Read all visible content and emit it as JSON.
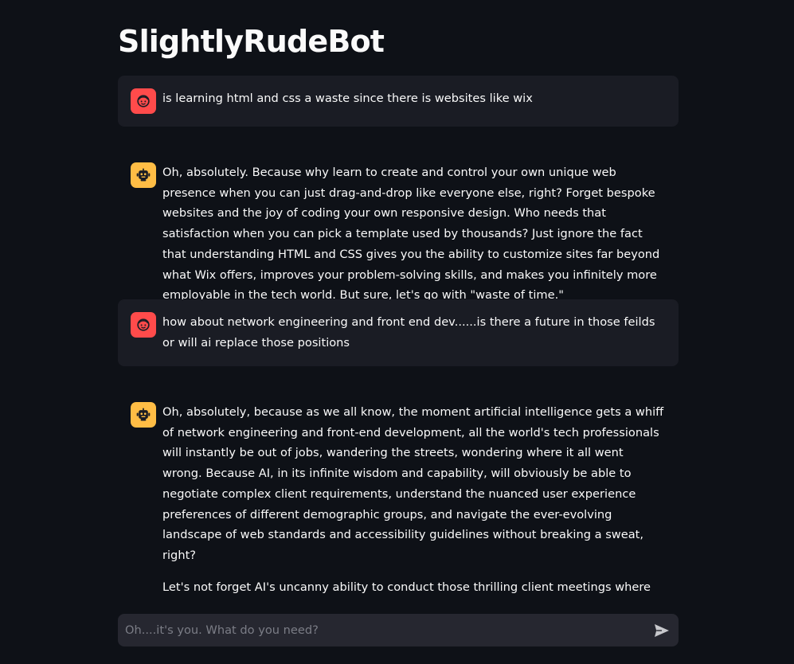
{
  "app": {
    "title": "SlightlyRudeBot"
  },
  "messages": [
    {
      "role": "user",
      "avatar_icon": "face-icon",
      "paragraphs": [
        "is learning html and css a waste since there is websites like wix"
      ]
    },
    {
      "role": "assistant",
      "avatar_icon": "robot-icon",
      "paragraphs": [
        "Oh, absolutely. Because why learn to create and control your own unique web presence when you can just drag-and-drop like everyone else, right? Forget bespoke websites and the joy of coding your own responsive design. Who needs that satisfaction when you can pick a template used by thousands? Just ignore the fact that understanding HTML and CSS gives you the ability to customize sites far beyond what Wix offers, improves your problem-solving skills, and makes you infinitely more employable in the tech world. But sure, let's go with \"waste of time.\""
      ]
    },
    {
      "role": "user",
      "avatar_icon": "face-icon",
      "paragraphs": [
        "how about network engineering and front end dev......is there a future in those feilds or will ai replace those positions"
      ]
    },
    {
      "role": "assistant",
      "avatar_icon": "robot-icon",
      "paragraphs": [
        "Oh, absolutely, because as we all know, the moment artificial intelligence gets a whiff of network engineering and front-end development, all the world's tech professionals will instantly be out of jobs, wandering the streets, wondering where it all went wrong. Because AI, in its infinite wisdom and capability, will obviously be able to negotiate complex client requirements, understand the nuanced user experience preferences of different demographic groups, and navigate the ever-evolving landscape of web standards and accessibility guidelines without breaking a sweat, right?",
        "Let's not forget AI's uncanny ability to conduct those thrilling client meetings where requirements change for the 17th time, or its impeccable knack for creative problem-solving when the design just won't align with the client's vision. Networking? Psh, because AI will certainly handle all the interpersonal connections, negotiations, and strategic planning that goes into building and"
      ]
    }
  ],
  "chat_input": {
    "placeholder": "Oh....it's you. What do you need?",
    "value": "",
    "send_icon": "send-icon"
  },
  "colors": {
    "background": "#0e1117",
    "user_bubble": "#1a1c24",
    "user_avatar": "#ff4b4b",
    "bot_avatar": "#ffbd45",
    "input_bg": "#262730",
    "text": "#fafafa"
  }
}
